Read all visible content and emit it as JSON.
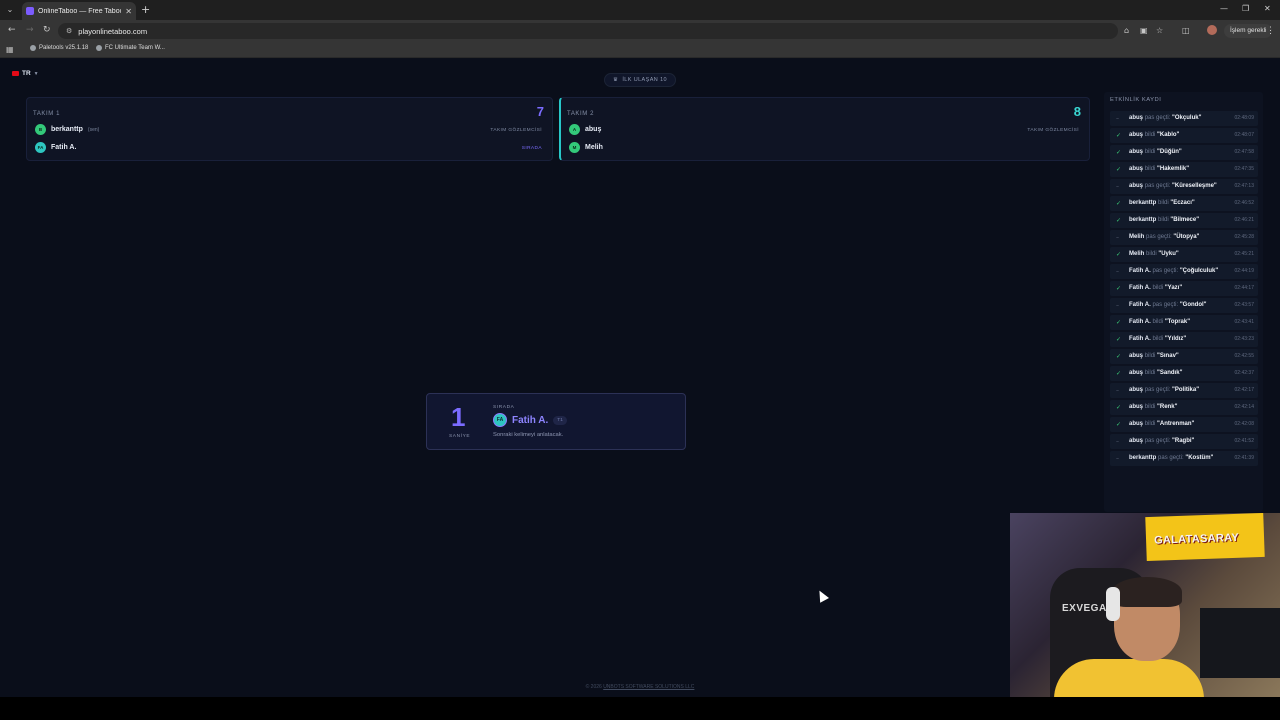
{
  "browser": {
    "tab_title": "OnlineTaboo — Free Taboo Ga",
    "url": "playonlinetaboo.com",
    "pending_label": "İşlem gerekli",
    "bookmarks": [
      "Paletools v25.1.18",
      "FC Ultimate Team W..."
    ]
  },
  "header": {
    "language": "TR",
    "first_to": "İLK ULAŞAN 10"
  },
  "teams": [
    {
      "name": "TAKIM 1",
      "score": "7",
      "observer_label": "TAKIM GÖZLEMCİSİ",
      "players": [
        {
          "name": "berkanttp",
          "initials": "B",
          "tag": "(sen)"
        },
        {
          "name": "Fatih A.",
          "initials": "FA",
          "tag": ""
        }
      ],
      "turn_label": "SIRADA"
    },
    {
      "name": "TAKIM 2",
      "score": "8",
      "observer_label": "TAKIM GÖZLEMCİSİ",
      "players": [
        {
          "name": "abuş",
          "initials": "A",
          "tag": ""
        },
        {
          "name": "Melih",
          "initials": "M",
          "tag": ""
        }
      ]
    }
  ],
  "turn_card": {
    "countdown": "1",
    "countdown_unit": "SANİYE",
    "next_label": "SIRADA",
    "player_name": "Fatih A.",
    "player_initials": "FA",
    "team_badge": "T1",
    "description": "Sonraki kelimeyi anlatacak."
  },
  "log": {
    "title": "ETKİNLİK KAYDI",
    "items": [
      {
        "player": "abuş",
        "action": "pas geçti:",
        "word": "\"Okçuluk\"",
        "time": "02:48:09",
        "status": "pass"
      },
      {
        "player": "abuş",
        "action": "bildi",
        "word": "\"Kablo\"",
        "time": "02:48:07",
        "status": "ok"
      },
      {
        "player": "abuş",
        "action": "bildi",
        "word": "\"Düğün\"",
        "time": "02:47:58",
        "status": "ok"
      },
      {
        "player": "abuş",
        "action": "bildi",
        "word": "\"Hakemlik\"",
        "time": "02:47:35",
        "status": "ok"
      },
      {
        "player": "abuş",
        "action": "pas geçti:",
        "word": "\"Küreselleşme\"",
        "time": "02:47:13",
        "status": "pass"
      },
      {
        "player": "berkanttp",
        "action": "bildi",
        "word": "\"Eczacı\"",
        "time": "02:46:52",
        "status": "ok"
      },
      {
        "player": "berkanttp",
        "action": "bildi",
        "word": "\"Bilmece\"",
        "time": "02:46:21",
        "status": "ok"
      },
      {
        "player": "Melih",
        "action": "pas geçti:",
        "word": "\"Ütopya\"",
        "time": "02:45:28",
        "status": "pass"
      },
      {
        "player": "Melih",
        "action": "bildi",
        "word": "\"Uyku\"",
        "time": "02:45:21",
        "status": "ok"
      },
      {
        "player": "Fatih A.",
        "action": "pas geçti:",
        "word": "\"Çoğulculuk\"",
        "time": "02:44:19",
        "status": "pass"
      },
      {
        "player": "Fatih A.",
        "action": "bildi",
        "word": "\"Yazı\"",
        "time": "02:44:17",
        "status": "ok"
      },
      {
        "player": "Fatih A.",
        "action": "pas geçti:",
        "word": "\"Gondol\"",
        "time": "02:43:57",
        "status": "pass"
      },
      {
        "player": "Fatih A.",
        "action": "bildi",
        "word": "\"Toprak\"",
        "time": "02:43:41",
        "status": "ok"
      },
      {
        "player": "Fatih A.",
        "action": "bildi",
        "word": "\"Yıldız\"",
        "time": "02:43:23",
        "status": "ok"
      },
      {
        "player": "abuş",
        "action": "bildi",
        "word": "\"Sınav\"",
        "time": "02:42:55",
        "status": "ok"
      },
      {
        "player": "abuş",
        "action": "bildi",
        "word": "\"Sandık\"",
        "time": "02:42:37",
        "status": "ok"
      },
      {
        "player": "abuş",
        "action": "pas geçti:",
        "word": "\"Politika\"",
        "time": "02:42:17",
        "status": "pass"
      },
      {
        "player": "abuş",
        "action": "bildi",
        "word": "\"Renk\"",
        "time": "02:42:14",
        "status": "ok"
      },
      {
        "player": "abuş",
        "action": "bildi",
        "word": "\"Antrenman\"",
        "time": "02:42:08",
        "status": "ok"
      },
      {
        "player": "abuş",
        "action": "pas geçti:",
        "word": "\"Ragbi\"",
        "time": "02:41:52",
        "status": "pass"
      },
      {
        "player": "berkanttp",
        "action": "pas geçti:",
        "word": "\"Kostüm\"",
        "time": "02:41:39",
        "status": "pass"
      }
    ]
  },
  "footer": {
    "copyright": "© 2026",
    "company": "UNBOTS SOFTWARE SOLUTIONS LLC"
  },
  "webcam": {
    "chair_brand": "EXVEGA",
    "banner_text": "GALATASARAY"
  },
  "colors": {
    "accent_purple": "#7b6cff",
    "accent_teal": "#3ad7d2",
    "success_green": "#3bd37a"
  }
}
